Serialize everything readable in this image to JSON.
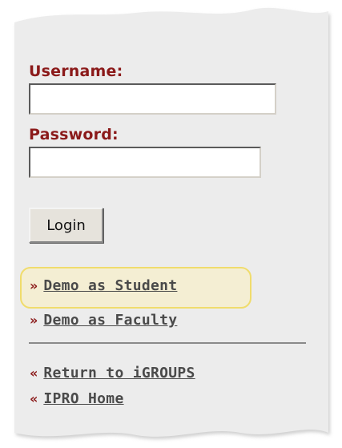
{
  "login_form": {
    "username_label": "Username:",
    "username_value": "",
    "password_label": "Password:",
    "password_value": "",
    "login_button": "Login"
  },
  "demo_links": [
    {
      "arrow": "»",
      "label": "Demo as Student",
      "highlighted": true
    },
    {
      "arrow": "»",
      "label": "Demo as Faculty",
      "highlighted": false
    }
  ],
  "return_links": [
    {
      "arrow": "«",
      "label": "Return to iGROUPS"
    },
    {
      "arrow": "«",
      "label": "IPRO Home"
    }
  ],
  "colors": {
    "label_red": "#8b1a1a",
    "link_gray": "#4a4a4a",
    "panel_gray": "#ececec",
    "highlight_fill": "#f4eed3",
    "highlight_border": "#f0dc6c"
  }
}
